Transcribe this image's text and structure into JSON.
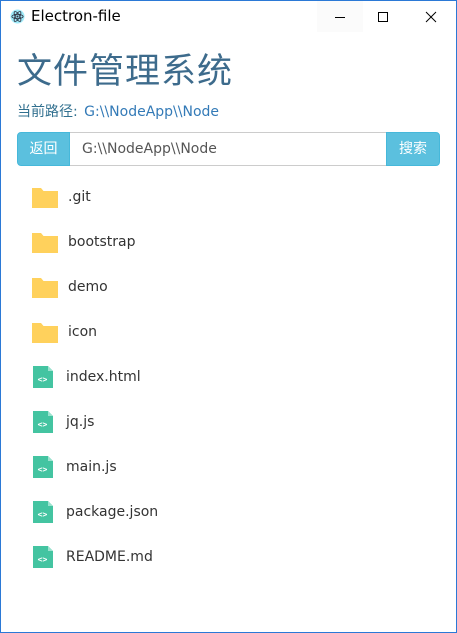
{
  "window": {
    "title": "Electron-file"
  },
  "header": {
    "title": "文件管理系统",
    "path_label": "当前路径:",
    "path_value": "G:\\\\NodeApp\\\\Node"
  },
  "search": {
    "back_label": "返回",
    "input_value": "G:\\\\NodeApp\\\\Node",
    "search_label": "搜索"
  },
  "files": [
    {
      "name": ".git",
      "type": "folder"
    },
    {
      "name": "bootstrap",
      "type": "folder"
    },
    {
      "name": "demo",
      "type": "folder"
    },
    {
      "name": "icon",
      "type": "folder"
    },
    {
      "name": "index.html",
      "type": "file"
    },
    {
      "name": "jq.js",
      "type": "file"
    },
    {
      "name": "main.js",
      "type": "file"
    },
    {
      "name": "package.json",
      "type": "file"
    },
    {
      "name": "README.md",
      "type": "file"
    }
  ],
  "colors": {
    "folder": "#ffd15c",
    "file": "#44c4a1",
    "accent": "#5bc0de",
    "title": "#3d6b8c"
  },
  "icons": {
    "folder": "folder-icon",
    "file": "code-file-icon"
  }
}
